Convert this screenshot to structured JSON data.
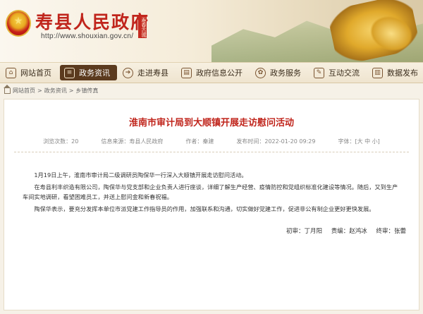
{
  "header": {
    "site_title": "寿县人民政府",
    "site_url": "http://www.shouxian.gov.cn/",
    "seal_text": "寿春古城"
  },
  "nav": {
    "items": [
      {
        "label": "网站首页",
        "icon": "home-icon",
        "active": false
      },
      {
        "label": "政务资讯",
        "icon": "news-icon",
        "active": true
      },
      {
        "label": "走进寿县",
        "icon": "arrow-icon",
        "active": false
      },
      {
        "label": "政府信息公开",
        "icon": "folder-icon",
        "active": false
      },
      {
        "label": "政务服务",
        "icon": "service-icon",
        "active": false
      },
      {
        "label": "互动交流",
        "icon": "chat-icon",
        "active": false
      },
      {
        "label": "数据发布",
        "icon": "data-icon",
        "active": false
      }
    ]
  },
  "breadcrumb": [
    "网站首页",
    "政务资讯",
    "乡镇传真"
  ],
  "article": {
    "title": "淮南市审计局到大顺镇开展走访慰问活动",
    "meta": {
      "views": "浏览次数：20",
      "source": "信息来源：寿县人民政府",
      "author": "作者：秦建",
      "time": "发布时间：2022-01-20 09:29",
      "font_size": "字体：[大 中 小]"
    },
    "paragraphs": [
      "1月19日上午，淮南市审计局二级调研员陶保华一行深入大顺镇开展走访慰问活动。",
      "在寿县利丰织造有限公司，陶保华与党支部和企业负责人进行座谈，详细了解生产经营、疫情防控和党组织标准化建设等情况。随后，又到生产车间实地调研，看望困难员工，并送上慰问金和新春祝福。",
      "陶保华表示，要充分发挥本单位市派党建工作指导员的作用，加强联系和沟通，切实做好党建工作，促进非公有制企业更好更快发展。"
    ],
    "sign": {
      "first_review": "初审：丁月阳",
      "editor": "责编：赵鸿冰",
      "final_review": "终审：张蕾"
    }
  }
}
